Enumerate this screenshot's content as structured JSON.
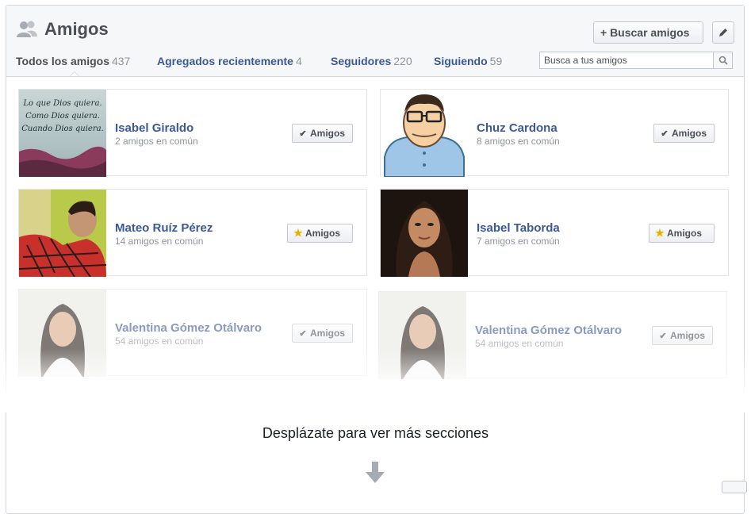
{
  "header": {
    "title": "Amigos",
    "find_friends_label": "+ Buscar amigos",
    "search_placeholder": "Busca a tus amigos"
  },
  "tabs": [
    {
      "label": "Todos los amigos",
      "count": "437",
      "active": true
    },
    {
      "label": "Agregados recientemente",
      "count": "4"
    },
    {
      "label": "Seguidores",
      "count": "220"
    },
    {
      "label": "Siguiendo",
      "count": "59"
    }
  ],
  "friends": [
    {
      "name": "Isabel Giraldo",
      "mutual": "2 amigos en común",
      "button": "Amigos",
      "button_icon": "check-icon",
      "photo_text": [
        "Lo que Dios quiera.",
        "Como Dios quiera.",
        "Cuando Dios quiera."
      ]
    },
    {
      "name": "Chuz Cardona",
      "mutual": "8 amigos en común",
      "button": "Amigos",
      "button_icon": "check-icon"
    },
    {
      "name": "Mateo Ruíz Pérez",
      "mutual": "14 amigos en común",
      "button": "Amigos",
      "button_icon": "star-icon"
    },
    {
      "name": "Isabel Taborda",
      "mutual": "7 amigos en común",
      "button": "Amigos",
      "button_icon": "star-icon"
    },
    {
      "name": "Valentina Gómez Otálvaro",
      "mutual": "54 amigos en común",
      "button": "Amigos",
      "button_icon": "check-icon"
    },
    {
      "name": "Valentina Gómez Otálvaro",
      "mutual": "54 amigos en común",
      "button": "Amigos",
      "button_icon": "check-icon"
    }
  ],
  "footer": {
    "scroll_hint": "Desplázate para ver más secciones"
  },
  "colors": {
    "link_blue": "#3b5998",
    "header_bg": "#f6f7f9",
    "star": "#e8b100"
  }
}
